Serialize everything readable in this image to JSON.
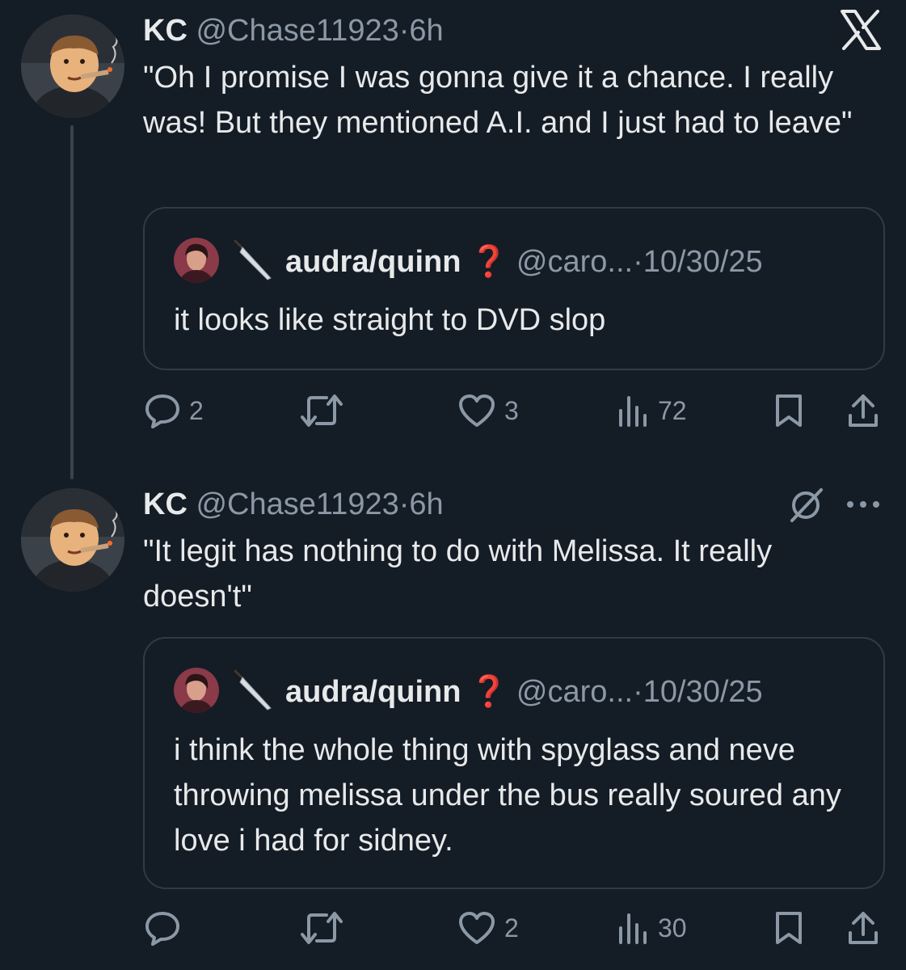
{
  "tweets": [
    {
      "name": "KC",
      "handle": "@Chase11923",
      "sep": "·",
      "time": "6h",
      "text": "\"Oh I promise I was gonna give it a chance.  I really was!  But they mentioned A.I. and I just had to leave\"",
      "quote": {
        "name": "audra/quinn",
        "badge": "❓",
        "handle": "@caro...",
        "sep": "·",
        "date": "10/30/25",
        "text": "it looks like straight to DVD slop"
      },
      "actions": {
        "replies": "2",
        "retweets": "",
        "likes": "3",
        "views": "72"
      }
    },
    {
      "name": "KC",
      "handle": "@Chase11923",
      "sep": "·",
      "time": "6h",
      "text": "\"It legit has nothing to do with Melissa.  It really doesn't\"",
      "quote": {
        "name": "audra/quinn",
        "badge": "❓",
        "handle": "@caro...",
        "sep": "·",
        "date": "10/30/25",
        "text": "i think the whole thing with spyglass and neve throwing melissa under the bus really soured any love i had for sidney."
      },
      "actions": {
        "replies": "",
        "retweets": "",
        "likes": "2",
        "views": "30"
      }
    }
  ],
  "colors": {
    "background": "#141c26",
    "text": "#e7e9ea",
    "muted": "#8b98a5",
    "border": "#2f3b47",
    "badge": "#e0245e"
  }
}
